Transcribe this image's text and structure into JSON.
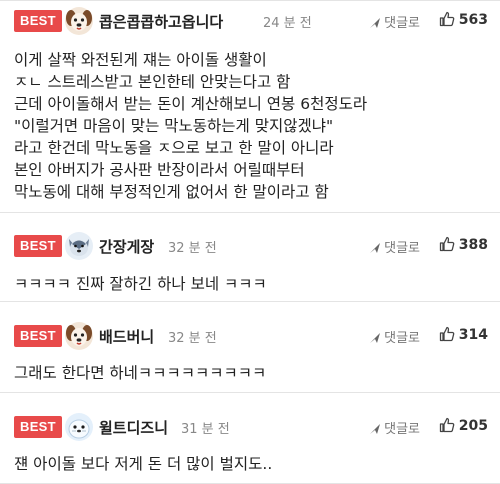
{
  "comments": [
    {
      "badge": "BEST",
      "nickname": "콥은콥콥하고옵니다",
      "time": "24 분 전",
      "reply_label": "댓글로",
      "likes": "563",
      "avatar": "dog-avatar",
      "body": "이게 살짝 와전된게 쟤는 아이돌 생활이\nㅈㄴ 스트레스받고 본인한테 안맞는다고 함\n근데 아이돌해서 받는 돈이 계산해보니 연봉 6천정도라\n\"이럴거면 마음이 맞는 막노동하는게 맞지않겠냐\"\n라고 한건데 막노동을 ㅈ으로 보고 한 말이 아니라\n본인 아버지가 공사판 반장이라서 어릴때부터\n막노동에 대해 부정적인게 없어서 한 말이라고 함"
    },
    {
      "badge": "BEST",
      "nickname": "간장게장",
      "time": "32 분 전",
      "reply_label": "댓글로",
      "likes": "388",
      "avatar": "wolf-avatar",
      "body": "ㅋㅋㅋㅋ 진짜 잘하긴 하나 보네 ㅋㅋㅋ"
    },
    {
      "badge": "BEST",
      "nickname": "배드버니",
      "time": "32 분 전",
      "reply_label": "댓글로",
      "likes": "314",
      "avatar": "dog-avatar",
      "body": "그래도 한다면 하네ㅋㅋㅋㅋㅋㅋㅋㅋㅋ"
    },
    {
      "badge": "BEST",
      "nickname": "윌트디즈니",
      "time": "31 분 전",
      "reply_label": "댓글로",
      "likes": "205",
      "avatar": "seal-avatar",
      "body": "쟨 아이돌 보다 저게 돈 더 많이 벌지도.."
    }
  ]
}
